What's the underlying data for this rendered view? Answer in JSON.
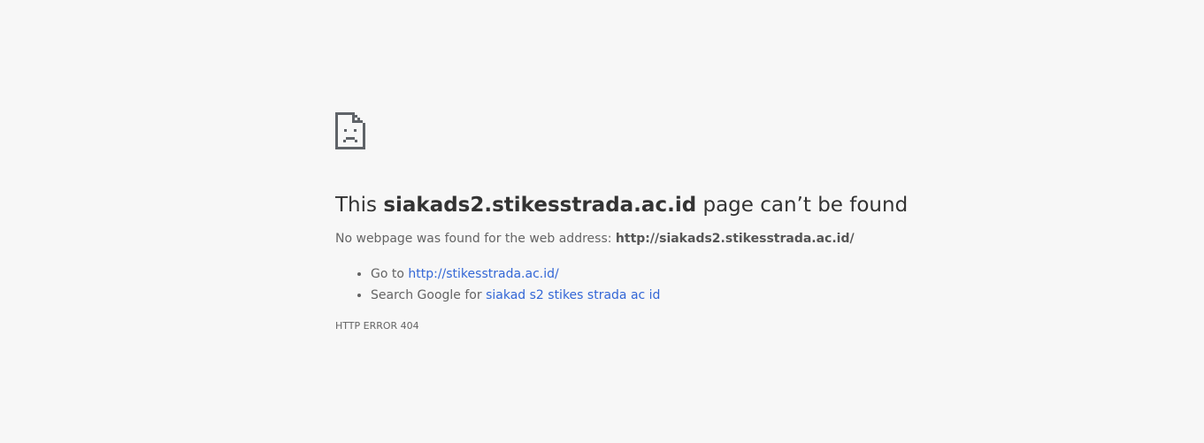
{
  "error_page": {
    "icon": "sad-document-icon",
    "headline": {
      "prefix": "This ",
      "host": "siakads2.stikesstrada.ac.id",
      "suffix": " page can’t be found"
    },
    "summary": {
      "text": "No webpage was found for the web address: ",
      "address": "http://siakads2.stikesstrada.ac.id/"
    },
    "suggestions": [
      {
        "prefix": "Go to ",
        "link": "http://stikesstrada.ac.id/"
      },
      {
        "prefix": "Search Google for ",
        "link": "siakad s2 stikes strada ac id"
      }
    ],
    "error_code": "HTTP ERROR 404"
  },
  "colors": {
    "background": "#f7f7f7",
    "headline": "#333333",
    "body_text": "#646464",
    "link": "#3367d6"
  }
}
